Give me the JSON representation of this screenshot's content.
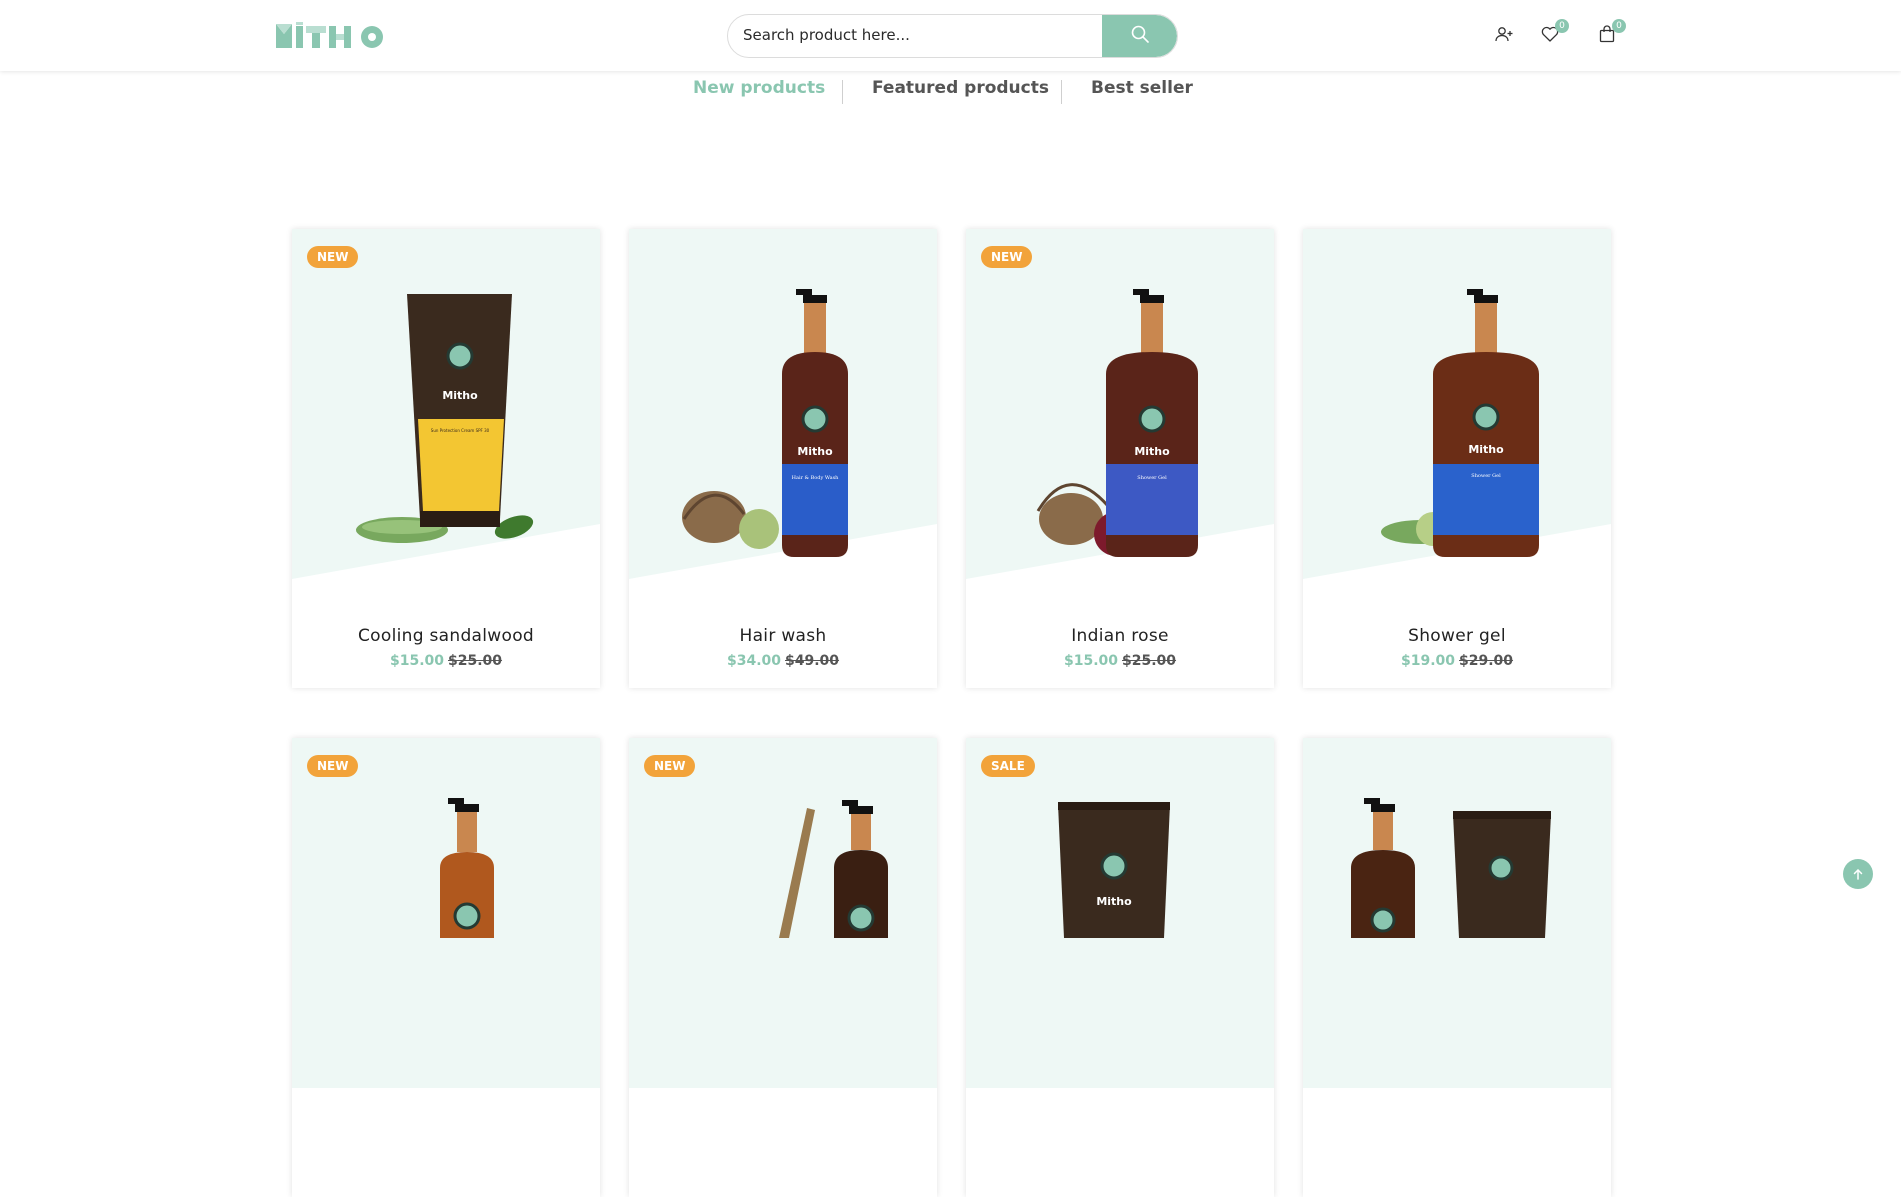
{
  "header": {
    "logo_text": "MITHO",
    "search": {
      "placeholder": "Search product here..."
    },
    "icons": {
      "account": "user-plus-icon",
      "wishlist": "heart-icon",
      "cart": "shopping-bag-icon"
    },
    "wishlist_count": "0",
    "cart_count": "0"
  },
  "tabs": [
    {
      "label": "New products",
      "active": true
    },
    {
      "label": "Featured products",
      "active": false
    },
    {
      "label": "Best seller",
      "active": false
    }
  ],
  "products": [
    {
      "name": "Cooling sandalwood",
      "price": "$15.00",
      "old_price": "$25.00",
      "tag": "NEW",
      "brand": "Mitho",
      "label": "Sun Protection Cream SPF 30"
    },
    {
      "name": "Hair wash",
      "price": "$34.00",
      "old_price": "$49.00",
      "tag": "",
      "brand": "Mitho",
      "label": "Hair & Body Wash"
    },
    {
      "name": "Indian rose",
      "price": "$15.00",
      "old_price": "$25.00",
      "tag": "NEW",
      "brand": "Mitho",
      "label": "Shower Gel"
    },
    {
      "name": "Shower gel",
      "price": "$19.00",
      "old_price": "$29.00",
      "tag": "",
      "brand": "Mitho",
      "label": "Shower Gel"
    },
    {
      "tag": "NEW"
    },
    {
      "tag": "NEW"
    },
    {
      "tag": "SALE",
      "brand": "Mitho"
    },
    {
      "tag": ""
    }
  ],
  "colors": {
    "accent": "#8ac6b0",
    "tag": "#f2a33a",
    "card_bg": "#eef8f5"
  },
  "scroll_top_icon": "arrow-up-icon"
}
